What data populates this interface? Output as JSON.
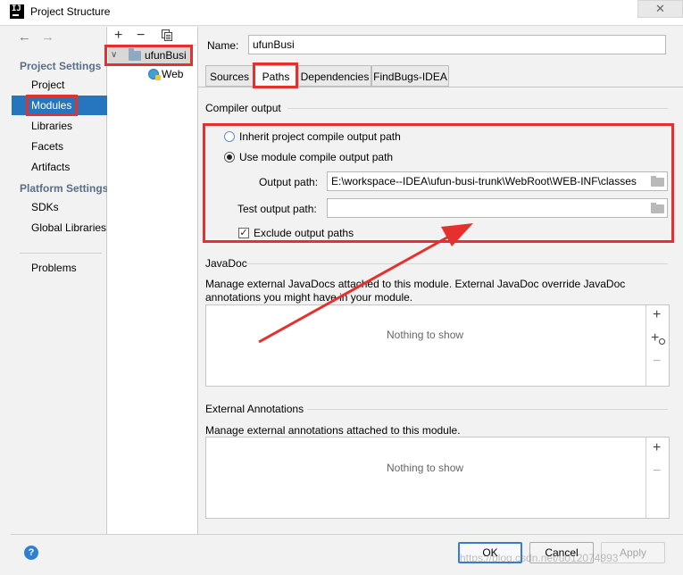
{
  "window": {
    "title": "Project Structure",
    "close": "✕"
  },
  "nav": {
    "back": "←",
    "forward": "→"
  },
  "sidebar": {
    "project_settings_title": "Project Settings",
    "project_items": [
      {
        "label": "Project"
      },
      {
        "label": "Modules"
      },
      {
        "label": "Libraries"
      },
      {
        "label": "Facets"
      },
      {
        "label": "Artifacts"
      }
    ],
    "platform_settings_title": "Platform Settings",
    "platform_items": [
      {
        "label": "SDKs"
      },
      {
        "label": "Global Libraries"
      }
    ],
    "problems": "Problems",
    "selected": "Modules"
  },
  "tree": {
    "add": "+",
    "remove": "−",
    "root": "ufunBusi",
    "child": "Web"
  },
  "module": {
    "name_label": "Name:",
    "name_value": "ufunBusi",
    "tabs": [
      {
        "label": "Sources"
      },
      {
        "label": "Paths"
      },
      {
        "label": "Dependencies"
      },
      {
        "label": "FindBugs-IDEA"
      }
    ],
    "active_tab": "Paths"
  },
  "compiler_output": {
    "title": "Compiler output",
    "inherit_label": "Inherit project compile output path",
    "use_module_label": "Use module compile output path",
    "selected_option": "Use module compile output path",
    "output_path_label": "Output path:",
    "output_path_value": "E:\\workspace--IDEA\\ufun-busi-trunk\\WebRoot\\WEB-INF\\classes",
    "test_output_path_label": "Test output path:",
    "test_output_path_value": "",
    "exclude_label": "Exclude output paths",
    "exclude_checked": true
  },
  "javadoc": {
    "title": "JavaDoc",
    "description": "Manage external JavaDocs attached to this module. External JavaDoc override JavaDoc annotations you might have in your module.",
    "empty_text": "Nothing to show",
    "add": "+",
    "add_url": "+",
    "remove": "−"
  },
  "annotations": {
    "title": "External Annotations",
    "description": "Manage external annotations attached to this module.",
    "empty_text": "Nothing to show",
    "add": "+",
    "remove": "−"
  },
  "footer": {
    "help": "?",
    "ok": "OK",
    "cancel": "Cancel",
    "apply": "Apply"
  },
  "watermark": "https://blog.csdn.net/u012074993",
  "colors": {
    "selection": "#2675bf",
    "annotation_red": "#e5302d"
  }
}
